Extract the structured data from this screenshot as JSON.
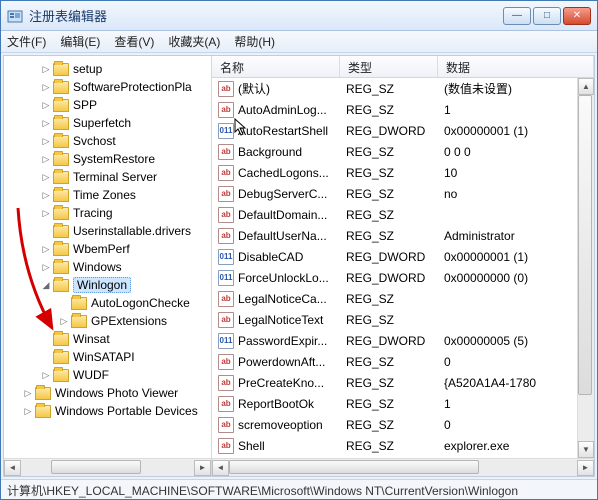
{
  "window": {
    "title": "注册表编辑器"
  },
  "menubar": [
    "文件(F)",
    "编辑(E)",
    "查看(V)",
    "收藏夹(A)",
    "帮助(H)"
  ],
  "tree": [
    {
      "label": "setup",
      "indent": 1,
      "exp": "▷"
    },
    {
      "label": "SoftwareProtectionPla",
      "indent": 1,
      "exp": "▷"
    },
    {
      "label": "SPP",
      "indent": 1,
      "exp": "▷"
    },
    {
      "label": "Superfetch",
      "indent": 1,
      "exp": "▷"
    },
    {
      "label": "Svchost",
      "indent": 1,
      "exp": "▷"
    },
    {
      "label": "SystemRestore",
      "indent": 1,
      "exp": "▷"
    },
    {
      "label": "Terminal Server",
      "indent": 1,
      "exp": "▷"
    },
    {
      "label": "Time Zones",
      "indent": 1,
      "exp": "▷"
    },
    {
      "label": "Tracing",
      "indent": 1,
      "exp": "▷"
    },
    {
      "label": "Userinstallable.drivers",
      "indent": 1,
      "exp": ""
    },
    {
      "label": "WbemPerf",
      "indent": 1,
      "exp": "▷"
    },
    {
      "label": "Windows",
      "indent": 1,
      "exp": "▷"
    },
    {
      "label": "Winlogon",
      "indent": 1,
      "exp": "◢",
      "selected": true
    },
    {
      "label": "AutoLogonChecke",
      "indent": 2,
      "exp": ""
    },
    {
      "label": "GPExtensions",
      "indent": 2,
      "exp": "▷"
    },
    {
      "label": "Winsat",
      "indent": 1,
      "exp": ""
    },
    {
      "label": "WinSATAPI",
      "indent": 1,
      "exp": ""
    },
    {
      "label": "WUDF",
      "indent": 1,
      "exp": "▷"
    },
    {
      "label": "Windows Photo Viewer",
      "indent": 0,
      "exp": "▷"
    },
    {
      "label": "Windows Portable Devices",
      "indent": 0,
      "exp": "▷"
    }
  ],
  "columns": {
    "name": "名称",
    "type": "类型",
    "data": "数据"
  },
  "rows": [
    {
      "icon": "str",
      "name": "(默认)",
      "type": "REG_SZ",
      "data": "(数值未设置)"
    },
    {
      "icon": "str",
      "name": "AutoAdminLog...",
      "type": "REG_SZ",
      "data": "1"
    },
    {
      "icon": "bin",
      "name": "AutoRestartShell",
      "type": "REG_DWORD",
      "data": "0x00000001 (1)"
    },
    {
      "icon": "str",
      "name": "Background",
      "type": "REG_SZ",
      "data": "0 0 0"
    },
    {
      "icon": "str",
      "name": "CachedLogons...",
      "type": "REG_SZ",
      "data": "10"
    },
    {
      "icon": "str",
      "name": "DebugServerC...",
      "type": "REG_SZ",
      "data": "no"
    },
    {
      "icon": "str",
      "name": "DefaultDomain...",
      "type": "REG_SZ",
      "data": ""
    },
    {
      "icon": "str",
      "name": "DefaultUserNa...",
      "type": "REG_SZ",
      "data": "Administrator"
    },
    {
      "icon": "bin",
      "name": "DisableCAD",
      "type": "REG_DWORD",
      "data": "0x00000001 (1)"
    },
    {
      "icon": "bin",
      "name": "ForceUnlockLo...",
      "type": "REG_DWORD",
      "data": "0x00000000 (0)"
    },
    {
      "icon": "str",
      "name": "LegalNoticeCa...",
      "type": "REG_SZ",
      "data": ""
    },
    {
      "icon": "str",
      "name": "LegalNoticeText",
      "type": "REG_SZ",
      "data": ""
    },
    {
      "icon": "bin",
      "name": "PasswordExpir...",
      "type": "REG_DWORD",
      "data": "0x00000005 (5)"
    },
    {
      "icon": "str",
      "name": "PowerdownAft...",
      "type": "REG_SZ",
      "data": "0"
    },
    {
      "icon": "str",
      "name": "PreCreateKno...",
      "type": "REG_SZ",
      "data": "{A520A1A4-1780"
    },
    {
      "icon": "str",
      "name": "ReportBootOk",
      "type": "REG_SZ",
      "data": "1"
    },
    {
      "icon": "str",
      "name": "scremoveoption",
      "type": "REG_SZ",
      "data": "0"
    },
    {
      "icon": "str",
      "name": "Shell",
      "type": "REG_SZ",
      "data": "explorer.exe"
    }
  ],
  "statusbar": "计算机\\HKEY_LOCAL_MACHINE\\SOFTWARE\\Microsoft\\Windows NT\\CurrentVersion\\Winlogon"
}
